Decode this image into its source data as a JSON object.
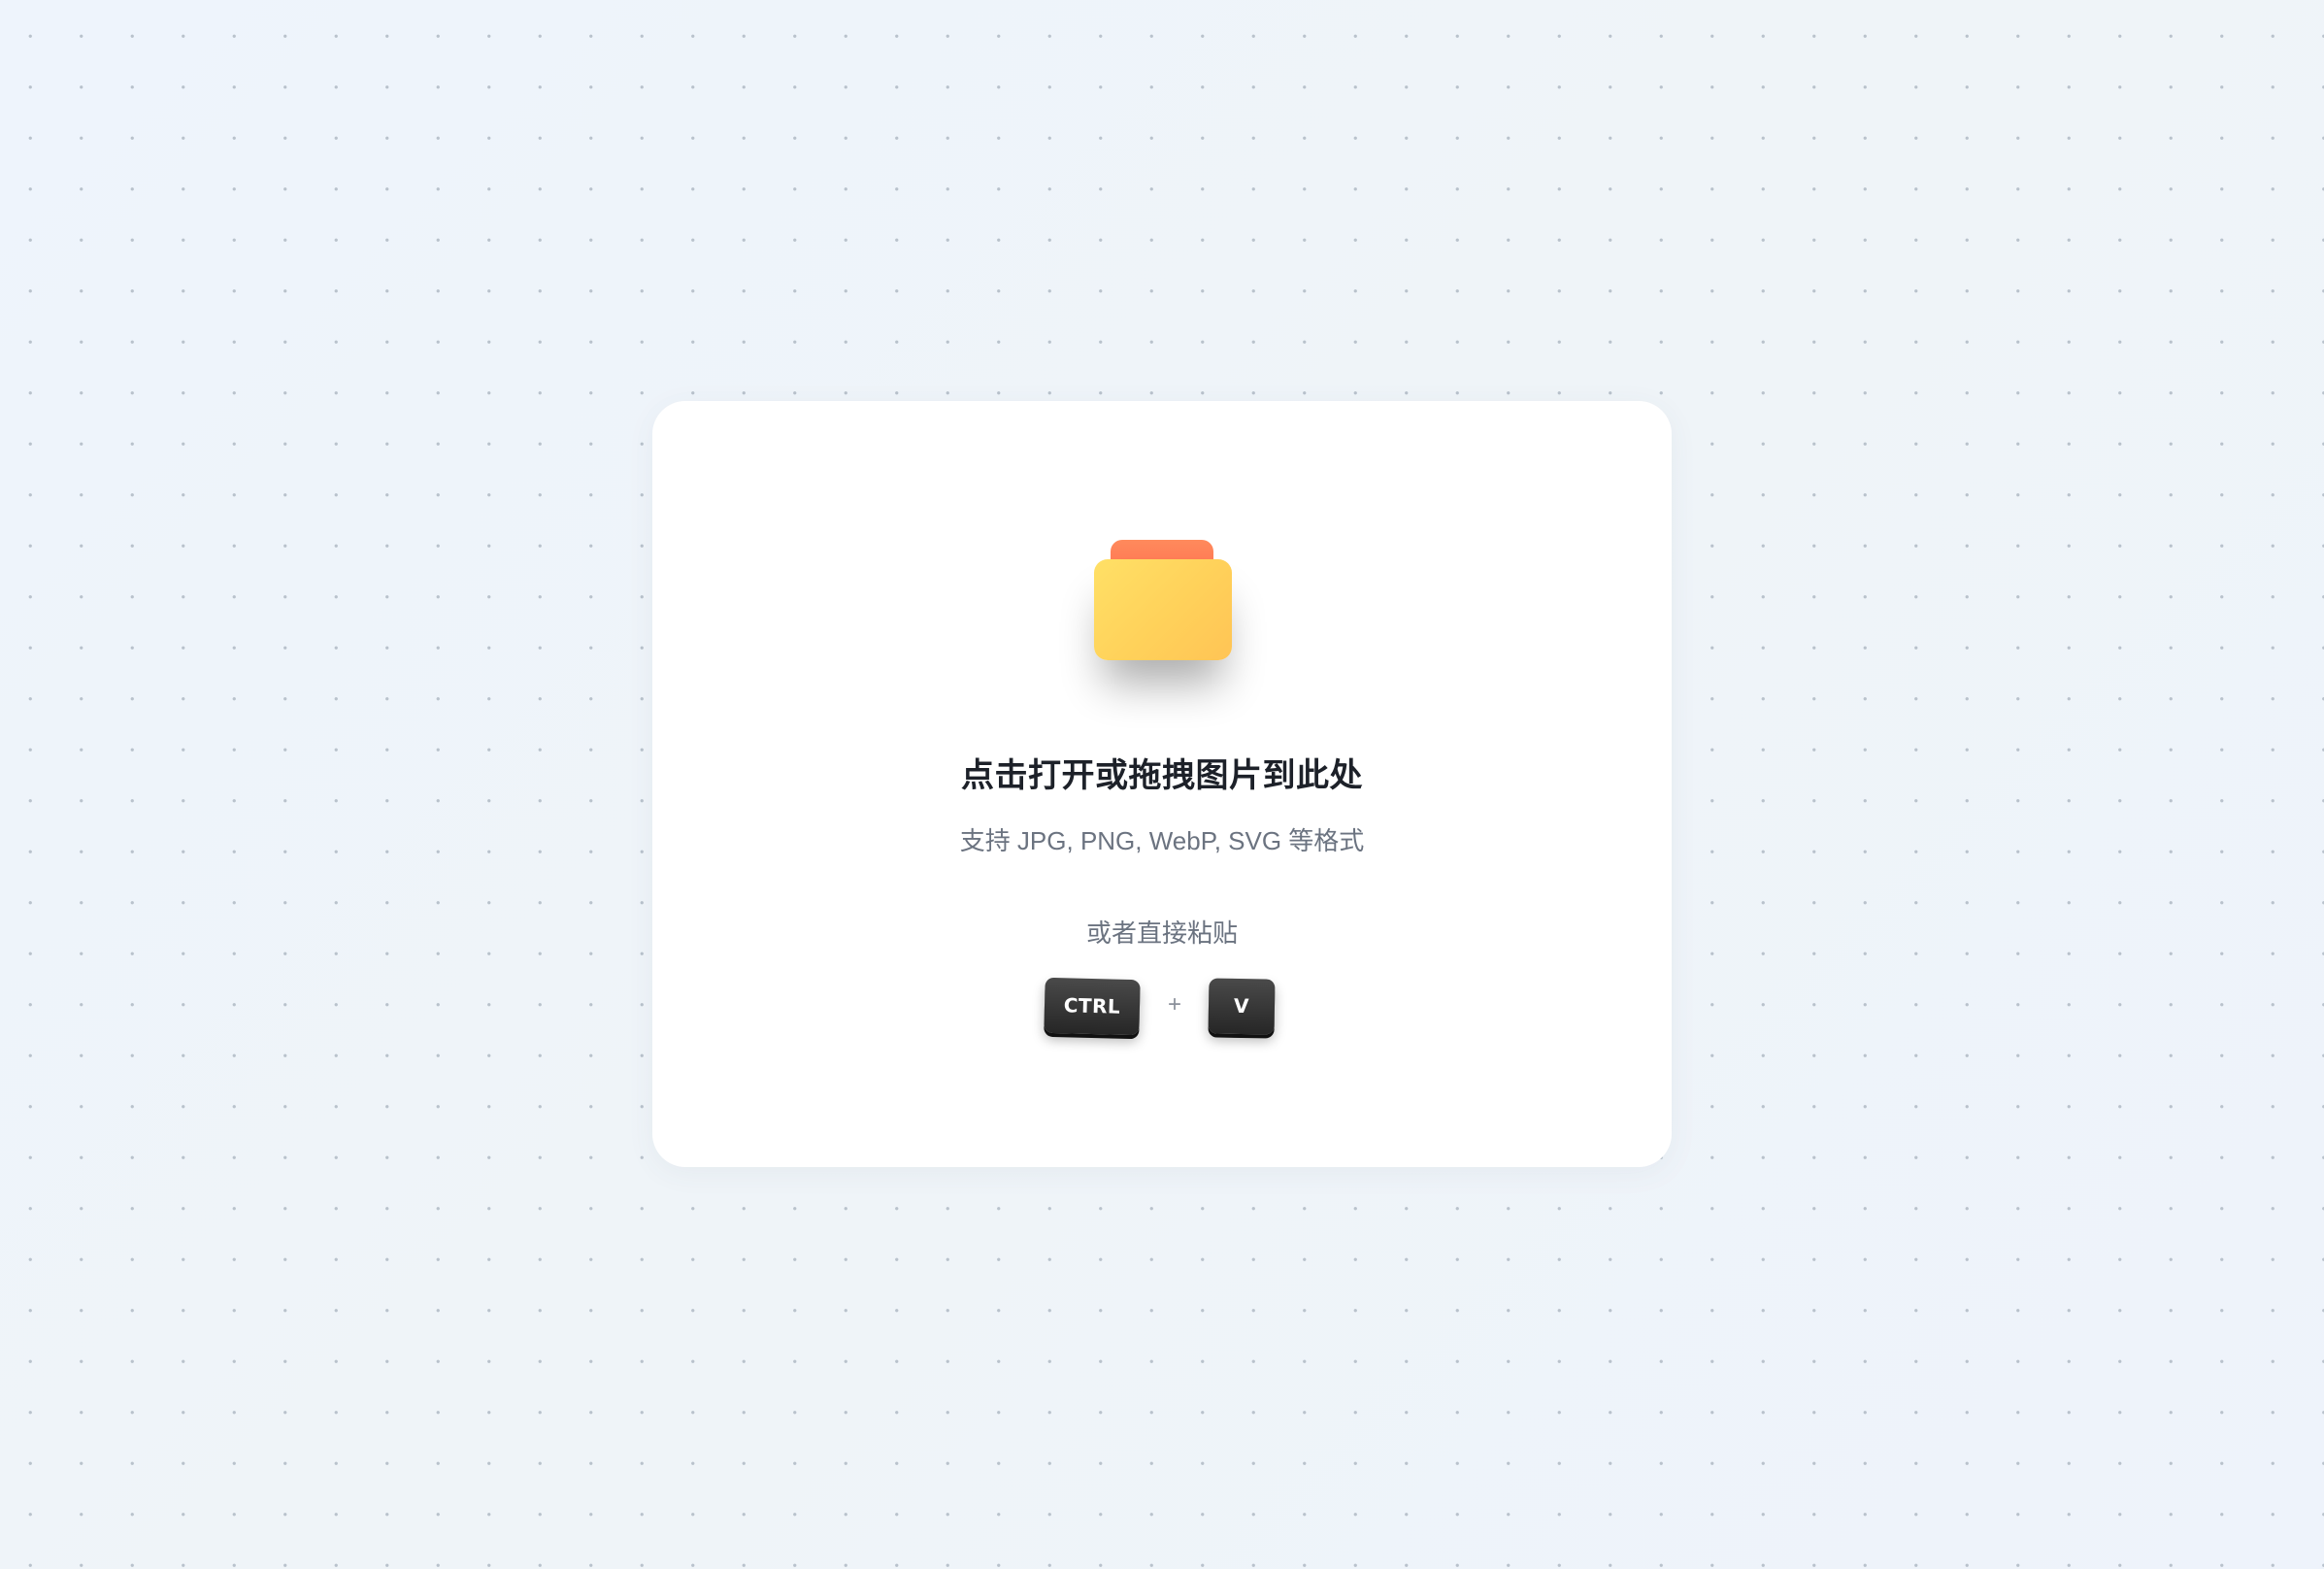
{
  "upload_area": {
    "icon": "folder-icon",
    "title": "点击打开或拖拽图片到此处",
    "formats_hint": "支持 JPG, PNG, WebP, SVG 等格式",
    "paste_hint": "或者直接粘贴",
    "shortcut": {
      "key1": "CTRL",
      "separator": "+",
      "key2": "V"
    }
  },
  "colors": {
    "background": "#f0f5fa",
    "card": "#ffffff",
    "folder_body": "#ffd15a",
    "folder_tab": "#ff7a55",
    "title_text": "#1d2129",
    "hint_text": "#6b7380",
    "key": "#2e2e2e"
  }
}
